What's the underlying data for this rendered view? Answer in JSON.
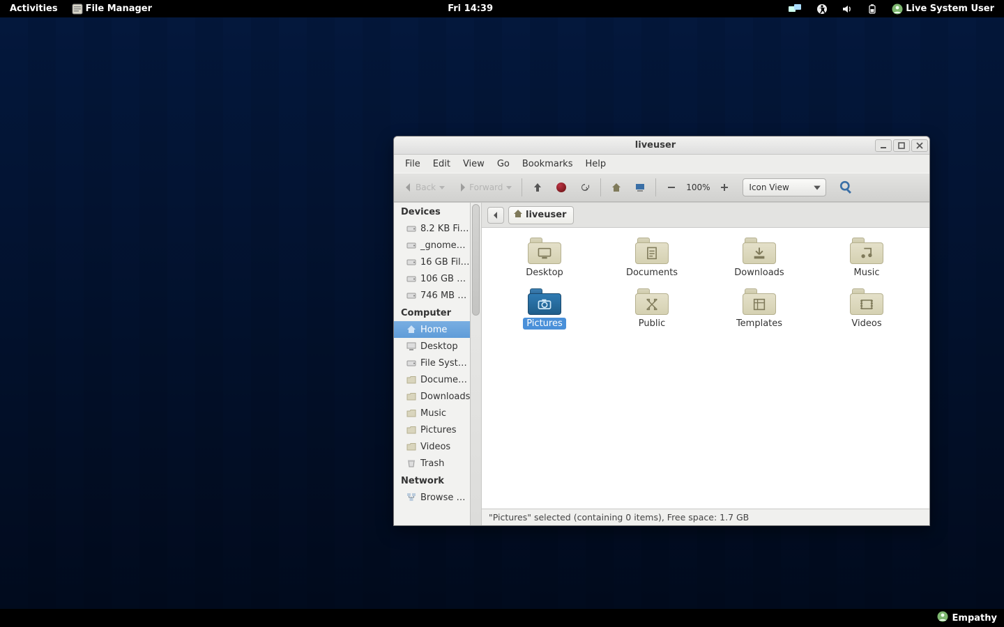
{
  "topbar": {
    "activities": "Activities",
    "app_name": "File Manager",
    "clock": "Fri 14:39",
    "user": "Live System User"
  },
  "bottombar": {
    "empathy": "Empathy"
  },
  "window": {
    "title": "liveuser",
    "menus": [
      "File",
      "Edit",
      "View",
      "Go",
      "Bookmarks",
      "Help"
    ],
    "toolbar": {
      "back_label": "Back",
      "forward_label": "Forward",
      "zoom": "100%",
      "view_mode": "Icon View"
    },
    "path": {
      "segment": "liveuser"
    },
    "sidebar": {
      "groups": [
        {
          "header": "Devices",
          "items": [
            {
              "icon": "drive-icon",
              "label": "8.2 KB Fi…"
            },
            {
              "icon": "drive-icon",
              "label": "_gnome…"
            },
            {
              "icon": "drive-icon",
              "label": "16 GB Fil…"
            },
            {
              "icon": "drive-icon",
              "label": "106 GB …"
            },
            {
              "icon": "drive-icon",
              "label": "746 MB …"
            }
          ]
        },
        {
          "header": "Computer",
          "items": [
            {
              "icon": "home-icon",
              "label": "Home",
              "active": true
            },
            {
              "icon": "desktop-icon",
              "label": "Desktop"
            },
            {
              "icon": "drive-icon",
              "label": "File Syst…"
            },
            {
              "icon": "folder-icon",
              "label": "Docume…"
            },
            {
              "icon": "folder-icon",
              "label": "Downloads"
            },
            {
              "icon": "folder-icon",
              "label": "Music"
            },
            {
              "icon": "folder-icon",
              "label": "Pictures"
            },
            {
              "icon": "folder-icon",
              "label": "Videos"
            },
            {
              "icon": "trash-icon",
              "label": "Trash"
            }
          ]
        },
        {
          "header": "Network",
          "items": [
            {
              "icon": "network-icon",
              "label": "Browse …"
            }
          ]
        }
      ]
    },
    "folders": [
      {
        "name": "Desktop",
        "glyph": "desktop-glyph"
      },
      {
        "name": "Documents",
        "glyph": "doc-glyph"
      },
      {
        "name": "Downloads",
        "glyph": "download-glyph"
      },
      {
        "name": "Music",
        "glyph": "music-glyph"
      },
      {
        "name": "Pictures",
        "glyph": "camera-glyph",
        "selected": true
      },
      {
        "name": "Public",
        "glyph": "public-glyph"
      },
      {
        "name": "Templates",
        "glyph": "template-glyph"
      },
      {
        "name": "Videos",
        "glyph": "video-glyph"
      }
    ],
    "status": "\"Pictures\" selected (containing 0 items), Free space: 1.7 GB"
  }
}
